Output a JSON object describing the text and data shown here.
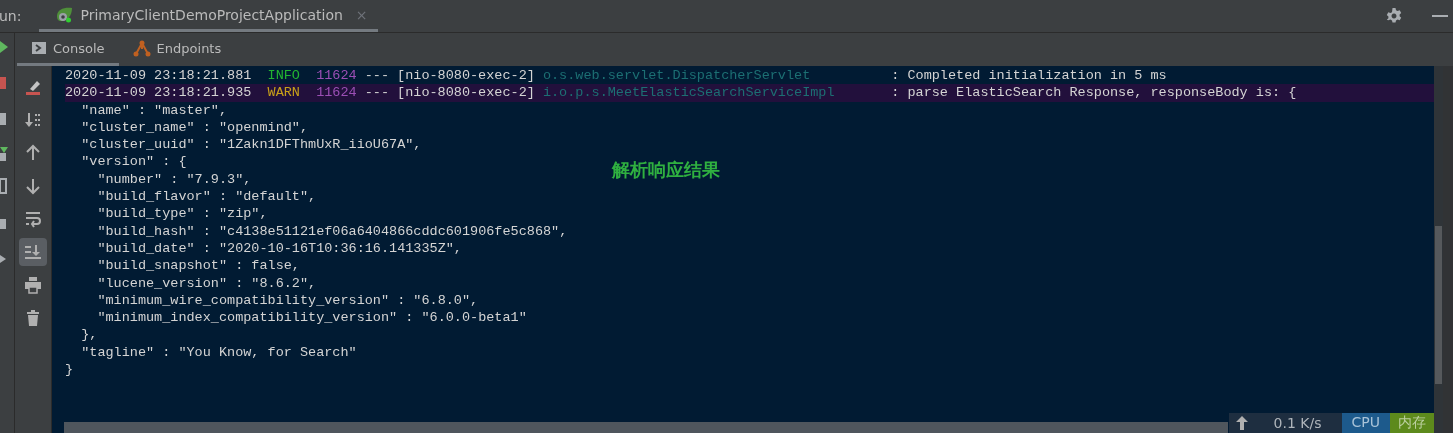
{
  "run_bar": {
    "label": "un:",
    "tab": {
      "title": "PrimaryClientDemoProjectApplication",
      "close": "×",
      "selected": true
    }
  },
  "subtabs": [
    {
      "label": "Console",
      "kind": "console",
      "selected": true
    },
    {
      "label": "Endpoints",
      "kind": "endpoints",
      "selected": false
    }
  ],
  "toolbar": [
    {
      "kind": "clear",
      "selected": false
    },
    {
      "kind": "sort",
      "selected": false
    },
    {
      "kind": "up",
      "selected": false
    },
    {
      "kind": "down",
      "selected": false
    },
    {
      "kind": "wrap",
      "selected": false
    },
    {
      "kind": "scroll-end",
      "selected": true
    },
    {
      "kind": "print",
      "selected": false
    },
    {
      "kind": "trash",
      "selected": false
    }
  ],
  "log_lines": [
    {
      "timestamp": "2020-11-09 23:18:21.881",
      "level": "INFO",
      "pid": "11624",
      "separator": "---",
      "thread": "[nio-8080-exec-2]",
      "logger": "o.s.web.servlet.DispatcherServlet",
      "message": ": Completed initialization in 5 ms"
    },
    {
      "timestamp": "2020-11-09 23:18:21.935",
      "level": "WARN",
      "pid": "11624",
      "separator": "---",
      "thread": "[nio-8080-exec-2]",
      "logger": "i.o.p.s.MeetElasticSearchServiceImpl",
      "message": ": parse ElasticSearch Response, responseBody is: {"
    }
  ],
  "output_lines": [
    "  \"name\" : \"master\",",
    "  \"cluster_name\" : \"openmind\",",
    "  \"cluster_uuid\" : \"1Zakn1DFThmUxR_iioU67A\",",
    "  \"version\" : {",
    "    \"number\" : \"7.9.3\",",
    "    \"build_flavor\" : \"default\",",
    "    \"build_type\" : \"zip\",",
    "    \"build_hash\" : \"c4138e51121ef06a6404866cddc601906fe5c868\",",
    "    \"build_date\" : \"2020-10-16T10:36:16.141335Z\",",
    "    \"build_snapshot\" : false,",
    "    \"lucene_version\" : \"8.6.2\",",
    "    \"minimum_wire_compatibility_version\" : \"6.8.0\",",
    "    \"minimum_index_compatibility_version\" : \"6.0.0-beta1\"",
    "  },",
    "  \"tagline\" : \"You Know, for Search\"",
    "}"
  ],
  "annotation": "解析响应结果",
  "status": {
    "speed": "0.1 K/s",
    "cpu": "CPU",
    "memory": "内存"
  }
}
